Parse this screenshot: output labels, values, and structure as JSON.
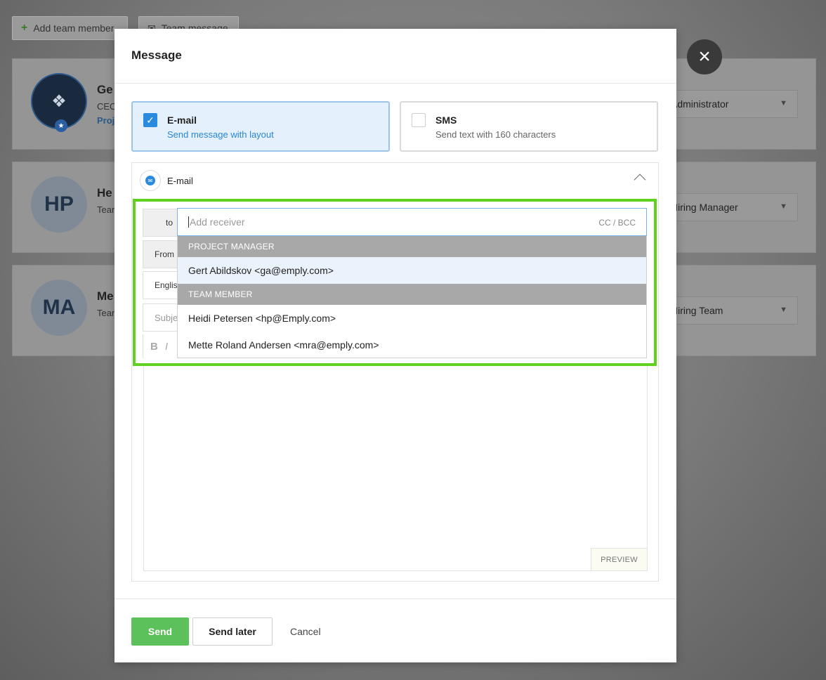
{
  "background": {
    "add_team_member": "Add team member",
    "team_message": "Team message",
    "members": [
      {
        "initials": "",
        "name": "Ge",
        "subtitle": "CEO",
        "link": "Proj",
        "role": "Administrator"
      },
      {
        "initials": "HP",
        "name": "He",
        "subtitle": "Tean",
        "role": "Hiring Manager"
      },
      {
        "initials": "MA",
        "name": "Me",
        "subtitle": "Tean",
        "role": "Hiring Team"
      }
    ]
  },
  "modal": {
    "title": "Message",
    "close_icon": "close-icon",
    "channels": {
      "email": {
        "title": "E-mail",
        "description": "Send message with layout",
        "checked": true
      },
      "sms": {
        "title": "SMS",
        "description": "Send text with 160 characters",
        "checked": false
      }
    },
    "compose": {
      "section_label": "E-mail",
      "to_label": "to",
      "from_label": "From",
      "language_value": "English",
      "subject_placeholder": "Subject",
      "receiver_placeholder": "Add receiver",
      "cc_bcc": "CC / BCC",
      "bold": "B",
      "italic": "I",
      "preview": "PREVIEW"
    },
    "receiver_dropdown": {
      "groups": [
        {
          "label": "PROJECT MANAGER",
          "items": [
            "Gert Abildskov <ga@emply.com>"
          ]
        },
        {
          "label": "TEAM MEMBER",
          "items": [
            "Heidi Petersen <hp@Emply.com>",
            "Mette Roland Andersen <mra@emply.com>"
          ]
        }
      ]
    },
    "footer": {
      "send": "Send",
      "send_later": "Send later",
      "cancel": "Cancel"
    }
  },
  "colors": {
    "highlight": "#5fd21f",
    "send_button": "#5cc15a",
    "accent_blue": "#2a8ae0"
  }
}
